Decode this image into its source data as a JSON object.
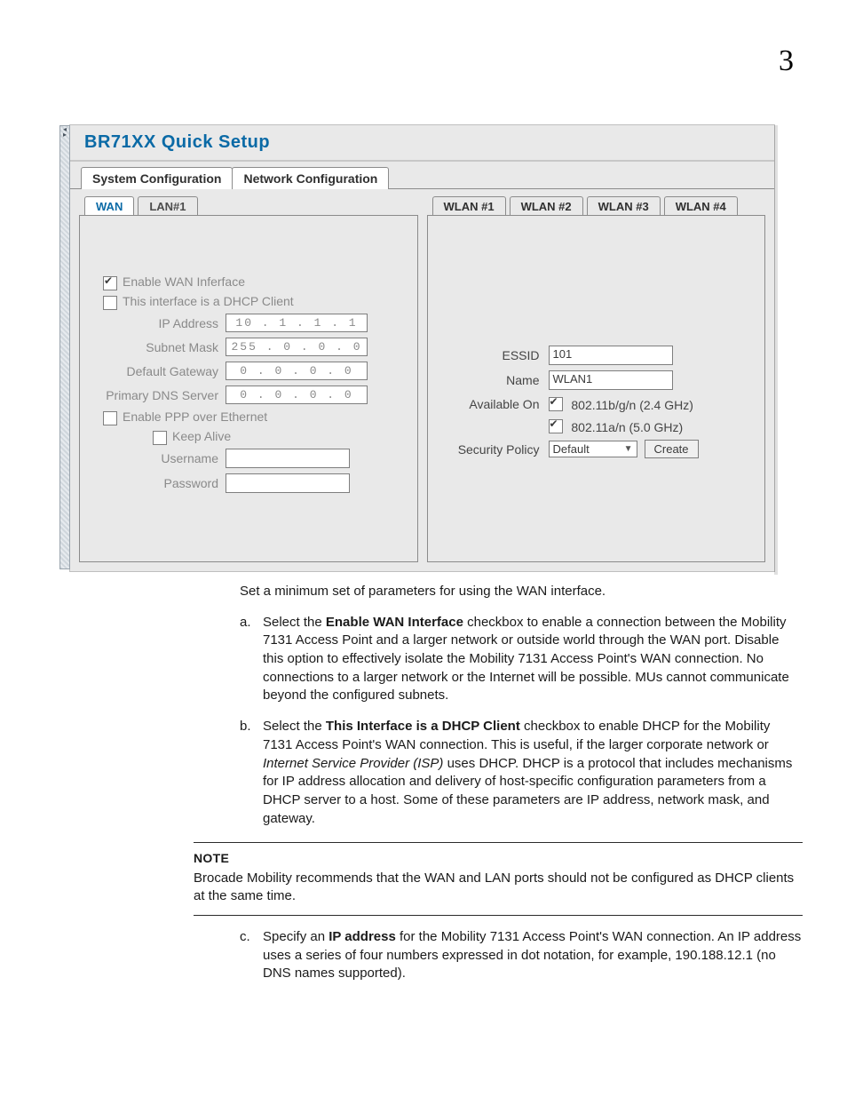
{
  "page_number": "3",
  "screenshot": {
    "title": "BR71XX Quick Setup",
    "top_tabs": {
      "active": "System Configuration",
      "other": "Network Configuration"
    },
    "left": {
      "tabs": {
        "active": "WAN",
        "other": "LAN#1"
      },
      "enable_wan_label": "Enable WAN Inferface",
      "enable_wan_checked": true,
      "dhcp_client_label": "This interface is a DHCP Client",
      "dhcp_client_checked": false,
      "ip_label": "IP Address",
      "ip_value": "10 .   1  .   1  .   1",
      "subnet_label": "Subnet Mask",
      "subnet_value": "255 .   0  .   0  .   0",
      "gateway_label": "Default Gateway",
      "gateway_value": "0  .   0  .   0  .   0",
      "dns_label": "Primary DNS Server",
      "dns_value": "0  .   0  .   0  .   0",
      "pppoe_label": "Enable PPP over Ethernet",
      "pppoe_checked": false,
      "keepalive_label": "Keep Alive",
      "keepalive_checked": false,
      "username_label": "Username",
      "password_label": "Password"
    },
    "right": {
      "tabs": [
        "WLAN #1",
        "WLAN #2",
        "WLAN #3",
        "WLAN #4"
      ],
      "active_tab": "WLAN #1",
      "essid_label": "ESSID",
      "essid_value": "101",
      "name_label": "Name",
      "name_value": "WLAN1",
      "available_label": "Available On",
      "band24_label": "802.11b/g/n (2.4 GHz)",
      "band24_checked": true,
      "band50_label": "802.11a/n (5.0 GHz)",
      "band50_checked": true,
      "secpolicy_label": "Security Policy",
      "secpolicy_value": "Default",
      "create_btn": "Create"
    }
  },
  "doc": {
    "intro": "Set a minimum set of parameters for using the WAN interface.",
    "a_marker": "a.",
    "a_pre": "Select the ",
    "a_bold": "Enable WAN Interface",
    "a_post": " checkbox to enable a connection between the Mobility 7131 Access Point and a larger network or outside world through the WAN port. Disable this option to effectively isolate the Mobility 7131 Access Point's WAN connection. No connections to a larger network or the Internet will be possible. MUs cannot communicate beyond the configured subnets.",
    "b_marker": "b.",
    "b_pre": "Select the ",
    "b_bold": "This Interface is a DHCP Client",
    "b_mid": " checkbox to enable DHCP for the Mobility 7131 Access Point's WAN connection. This is useful, if the larger corporate network or ",
    "b_ital": "Internet Service Provider (ISP)",
    "b_post": " uses DHCP. DHCP is a protocol that includes mechanisms for IP address allocation and delivery of host-specific configuration parameters from a DHCP server to a host. Some of these parameters are IP address, network mask, and gateway.",
    "note_label": "NOTE",
    "note_body": "Brocade Mobility recommends that the WAN and LAN ports should not be configured as DHCP clients at the same time.",
    "c_marker": "c.",
    "c_pre": "Specify an ",
    "c_bold": "IP address",
    "c_post": " for the Mobility 7131 Access Point's WAN connection. An IP address uses a series of four numbers expressed in dot notation, for example, 190.188.12.1 (no DNS names supported)."
  }
}
